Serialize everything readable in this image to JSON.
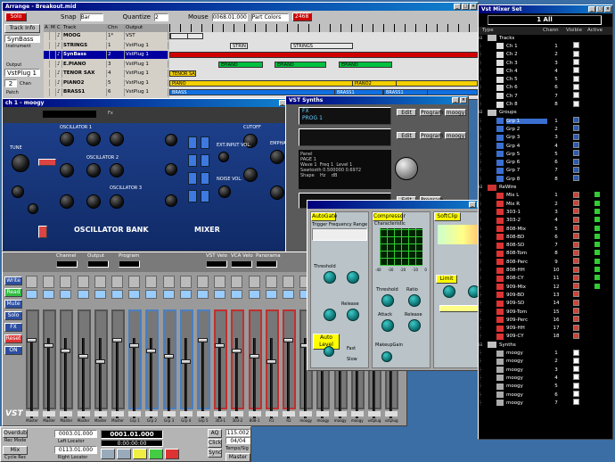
{
  "arrange": {
    "title": "Arrange - Breakout.mid",
    "solo": "Solo",
    "snap_label": "Snap",
    "snap_value": "Bar",
    "quantize_label": "Quantize",
    "quantize_value": "2",
    "mouse_label": "Mouse",
    "mouse_value": "0068.01.000",
    "part_colors": "Part Colors",
    "red_value": "2468",
    "track_info": "Track Info",
    "track_name": "SynBass",
    "instrument_label": "Instrument",
    "output_label": "Output",
    "output_value": "VstPlug 1",
    "chan_label": "Chan",
    "chan_value": "2",
    "patch_label": "Patch",
    "columns": [
      "A",
      "M",
      "C",
      "Track",
      "Chn",
      "Output"
    ],
    "tracks": [
      {
        "name": "MOOG",
        "chn": "1*",
        "out": "VST"
      },
      {
        "name": "STRINGS",
        "chn": "1",
        "out": "VstPlug 1"
      },
      {
        "name": "SynBass",
        "chn": "2",
        "out": "VstPlug 1"
      },
      {
        "name": "E.PIANO",
        "chn": "3",
        "out": "VstPlug 1"
      },
      {
        "name": "TENOR SAX",
        "chn": "4",
        "out": "VstPlug 1"
      },
      {
        "name": "PIANO2",
        "chn": "5",
        "out": "VstPlug 1"
      },
      {
        "name": "BRASS1",
        "chn": "6",
        "out": "VstPlug 1"
      }
    ],
    "parts": [
      "STRIN",
      "STRIN",
      "STRINGS",
      "EPIANO",
      "EPIANO",
      "EPIANO",
      "EPIANO",
      "TENOR SAX",
      "PIANO",
      "PIANO2",
      "BRASS",
      "BRASS1",
      "BRASS1"
    ]
  },
  "moog": {
    "title": "ch 1 - moogy",
    "top_label": "Fx",
    "labels": [
      "TUNE",
      "GLIDE",
      "MODULATION MIX",
      "OSCILLATOR 1",
      "OSCILLATOR 2",
      "OSCILLATOR 3",
      "WAVEFORM",
      "RANGE",
      "OSCILLATOR BANK",
      "MIXER",
      "EXT.INPUT VOL.",
      "NOISE VOL.",
      "WHITE",
      "PINK",
      "CUTOFF",
      "EMPHASIS",
      "ATTACK",
      "DECAY",
      "SUSTAIN",
      "OSC 3 CTRL",
      "VOLUME",
      "ON",
      "OFF"
    ]
  },
  "synths": {
    "title": "VST Synths",
    "fx": "FX",
    "prog": "PROG 1",
    "btns": [
      "Edit",
      "Program",
      "moogy"
    ],
    "panel": [
      "Panel",
      "PAGE 1",
      "Wave 1",
      "Freq 1",
      "Level 1",
      "Sawtooth",
      "0.500000",
      "0.6972",
      "Shape",
      "Hz",
      "dB"
    ]
  },
  "comp": {
    "title": "",
    "sections": [
      "AutoGate",
      "Compressor",
      "SoftClip",
      "Limit"
    ],
    "trigger": "Trigger Frequency Range",
    "ratio": "Ratio",
    "threshold": "Threshold",
    "release": "Release",
    "attack": "Attack",
    "opts": [
      "Fast",
      "Slow",
      "MakeupGain",
      "Characteristic",
      "Auto Level"
    ],
    "db_ticks": [
      "-40",
      "-30",
      "-20",
      "-10",
      "0"
    ]
  },
  "vstmix": {
    "title": "Vst Mixer Set",
    "dropdown": "1 All",
    "headers": [
      "Type",
      "Chann",
      "Visible",
      "Active"
    ],
    "groups": [
      {
        "name": "Tracks",
        "items": [
          {
            "n": "Ch 1",
            "c": "1"
          },
          {
            "n": "Ch 2",
            "c": "2"
          },
          {
            "n": "Ch 3",
            "c": "3"
          },
          {
            "n": "Ch 4",
            "c": "4"
          },
          {
            "n": "Ch 5",
            "c": "5"
          },
          {
            "n": "Ch 6",
            "c": "6"
          },
          {
            "n": "Ch 7",
            "c": "7"
          },
          {
            "n": "Ch 8",
            "c": "8"
          }
        ]
      },
      {
        "name": "Groups",
        "items": [
          {
            "n": "Grp 1",
            "c": "1"
          },
          {
            "n": "Grp 2",
            "c": "2"
          },
          {
            "n": "Grp 3",
            "c": "3"
          },
          {
            "n": "Grp 4",
            "c": "4"
          },
          {
            "n": "Grp 5",
            "c": "5"
          },
          {
            "n": "Grp 6",
            "c": "6"
          },
          {
            "n": "Grp 7",
            "c": "7"
          },
          {
            "n": "Grp 8",
            "c": "8"
          }
        ]
      },
      {
        "name": "ReWire",
        "items": [
          {
            "n": "Mix L",
            "c": "1"
          },
          {
            "n": "Mix R",
            "c": "2"
          },
          {
            "n": "303-1",
            "c": "3"
          },
          {
            "n": "303-2",
            "c": "4"
          },
          {
            "n": "808-Mix",
            "c": "5"
          },
          {
            "n": "808-BD",
            "c": "6"
          },
          {
            "n": "808-SD",
            "c": "7"
          },
          {
            "n": "808-Tom",
            "c": "8"
          },
          {
            "n": "808-Perc",
            "c": "9"
          },
          {
            "n": "808-HH",
            "c": "10"
          },
          {
            "n": "808-CY",
            "c": "11"
          },
          {
            "n": "909-Mix",
            "c": "12"
          },
          {
            "n": "909-BD",
            "c": "13"
          },
          {
            "n": "909-SD",
            "c": "14"
          },
          {
            "n": "909-Tom",
            "c": "15"
          },
          {
            "n": "909-Perc",
            "c": "16"
          },
          {
            "n": "909-HH",
            "c": "17"
          },
          {
            "n": "909-CY",
            "c": "18"
          }
        ]
      },
      {
        "name": "Synths",
        "items": [
          {
            "n": "moogy",
            "c": "1"
          },
          {
            "n": "moogy",
            "c": "2"
          },
          {
            "n": "moogy",
            "c": "3"
          },
          {
            "n": "moogy",
            "c": "4"
          },
          {
            "n": "moogy",
            "c": "5"
          },
          {
            "n": "moogy",
            "c": "6"
          },
          {
            "n": "moogy",
            "c": "7"
          }
        ]
      }
    ]
  },
  "channel": {
    "sections": [
      "Channel",
      "Output",
      "Program",
      "VST Velo",
      "VCA Velo",
      "Panorama"
    ],
    "left": [
      "Write",
      "Read",
      "Mute",
      "Solo",
      "FX",
      "Reset",
      "ON"
    ],
    "strip_labels": [
      "Master",
      "Master",
      "Master",
      "Master",
      "Master",
      "Master",
      "Grp 1",
      "Grp 2",
      "Grp 3",
      "Grp 4",
      "Grp 5",
      "303-1",
      "303-2",
      "808-1",
      "R1",
      "R2",
      "moogy",
      "moogy",
      "moogy",
      "moogy",
      "vstplug",
      "vstplug"
    ],
    "vst_logo": "VST"
  },
  "transport": {
    "overdub": "Overdub",
    "rec_mode": "Rec Mode",
    "mix": "Mix",
    "cycle": "Cycle Rec",
    "left_loc": "0003.01.000",
    "left_label": "Left Locator",
    "right_loc": "0113.01.000",
    "right_label": "Right Locator",
    "pos": "0001.01.000",
    "time": "0:00:00:00",
    "aq": "AQ",
    "click": "Click",
    "sync": "Sync",
    "tempo": "115.002",
    "sig": "04/04",
    "tempo_label": "Tempo/Sig",
    "master": "Master"
  }
}
